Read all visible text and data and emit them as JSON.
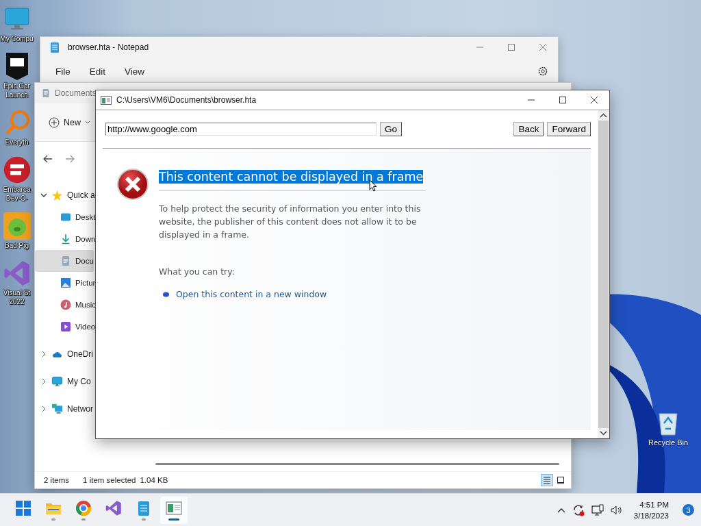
{
  "desktop_icons": [
    {
      "label": "My Compu",
      "kind": "computer"
    },
    {
      "label": "Epic Gar Launch",
      "kind": "epic"
    },
    {
      "label": "Everyth",
      "kind": "search"
    },
    {
      "label": "Embarca Dev-C-",
      "kind": "devcpp"
    },
    {
      "label": "Bad Pig",
      "kind": "game"
    },
    {
      "label": "Visual St 2022",
      "kind": "vs"
    }
  ],
  "notepad": {
    "title": "browser.hta - Notepad",
    "menu": [
      "File",
      "Edit",
      "View"
    ]
  },
  "explorer": {
    "title": "Documents",
    "new_button": "New",
    "sidebar": [
      {
        "label": "Quick a",
        "kind": "star",
        "expanded": true,
        "selected": false,
        "children": [
          {
            "label": "Deskt",
            "kind": "desktop",
            "selected": false
          },
          {
            "label": "Down",
            "kind": "download",
            "selected": false
          },
          {
            "label": "Docu",
            "kind": "document",
            "selected": true
          },
          {
            "label": "Pictur",
            "kind": "picture",
            "selected": false
          },
          {
            "label": "Music",
            "kind": "music",
            "selected": false
          },
          {
            "label": "Video",
            "kind": "video",
            "selected": false
          }
        ]
      },
      {
        "label": "OneDri",
        "kind": "cloud",
        "expanded": false,
        "selected": false
      },
      {
        "label": "My Co",
        "kind": "computer",
        "expanded": false,
        "selected": false
      },
      {
        "label": "Networ",
        "kind": "network",
        "expanded": false,
        "selected": false
      }
    ],
    "status_bar": {
      "item_count": "2 items",
      "selection": "1 item selected",
      "size": "1.04 KB"
    },
    "view_buttons": [
      {
        "kind": "details",
        "selected": true
      },
      {
        "kind": "tiles",
        "selected": false
      }
    ]
  },
  "hta": {
    "title": "C:\\Users\\VM6\\Documents\\browser.hta",
    "address": {
      "value": "http://www.google.com"
    },
    "go_button": "Go",
    "nav_buttons": [
      "Back",
      "Forward"
    ],
    "error": {
      "heading": "This content cannot be displayed in a frame",
      "heading_selected": true,
      "message": "To help protect the security of information you enter into this website, the publisher of this content does not allow it to be displayed in a frame.",
      "try_label": "What you can try:",
      "links": [
        "Open this content in a new window"
      ]
    }
  },
  "recycle_bin": {
    "label": "Recycle Bin"
  },
  "taskbar": {
    "apps": [
      {
        "kind": "start",
        "running": false,
        "active": false
      },
      {
        "kind": "folder",
        "running": true,
        "active": false
      },
      {
        "kind": "browser",
        "running": true,
        "active": false
      },
      {
        "kind": "vs",
        "running": false,
        "active": false
      },
      {
        "kind": "notepad",
        "running": true,
        "active": false
      },
      {
        "kind": "hta",
        "running": true,
        "active": true
      }
    ],
    "time": "4:51 PM",
    "date": "3/18/2023",
    "notifications": "3"
  }
}
